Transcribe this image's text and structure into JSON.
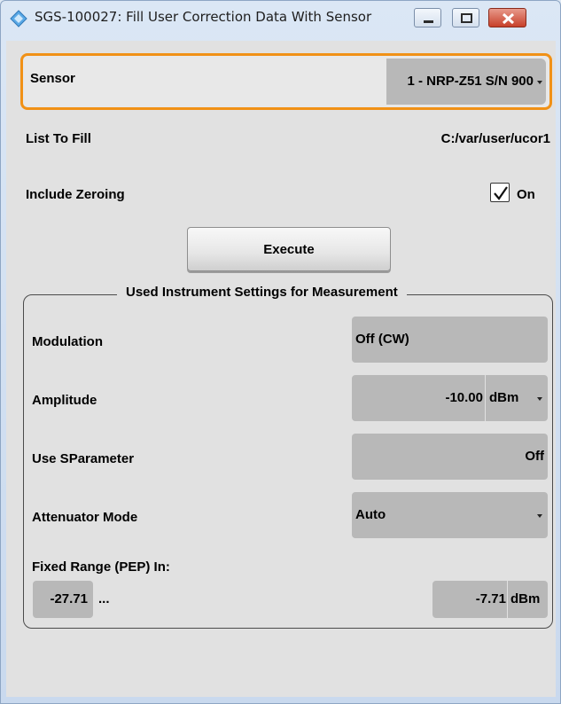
{
  "window": {
    "title": "SGS-100027: Fill User Correction Data With Sensor"
  },
  "sensor": {
    "label": "Sensor",
    "value": "1 - NRP-Z51 S/N 900"
  },
  "list_to_fill": {
    "label": "List To Fill",
    "value": "C:/var/user/ucor1"
  },
  "include_zeroing": {
    "label": "Include Zeroing",
    "checked": true,
    "state_label": "On"
  },
  "execute_label": "Execute",
  "group": {
    "title": "Used Instrument Settings for Measurement",
    "modulation": {
      "label": "Modulation",
      "value": "Off (CW)"
    },
    "amplitude": {
      "label": "Amplitude",
      "value": "-10.00",
      "unit": "dBm"
    },
    "use_sparameter": {
      "label": "Use SParameter",
      "value": "Off"
    },
    "attenuator_mode": {
      "label": "Attenuator Mode",
      "value": "Auto"
    },
    "fixed_range": {
      "label": "Fixed Range (PEP) In:",
      "min_value": "-27.71",
      "separator": "...",
      "max_value": "-7.71",
      "unit": "dBm"
    }
  },
  "colors": {
    "focus_border": "#f19116",
    "field_bg": "#b8b8b8",
    "panel_bg": "#e1e1e1",
    "close_button": "#c7402a"
  }
}
